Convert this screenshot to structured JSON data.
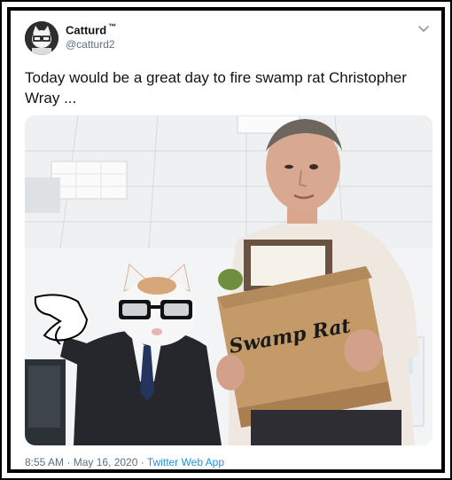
{
  "tweet": {
    "display_name": "Catturd",
    "tm_mark": "™",
    "handle": "@catturd2",
    "text": "Today would be a great day to fire swamp rat Christopher Wray ...",
    "image_caption_text": "Swamp Rat",
    "timestamp": "8:55 AM · May 16, 2020 · ",
    "source_app": "Twitter Web App"
  },
  "icons": {
    "menu": "chevron-down-icon",
    "avatar": "cat-avatar"
  },
  "colors": {
    "text_primary": "#0f1419",
    "text_secondary": "#5b7083",
    "link": "#1b95e0"
  }
}
